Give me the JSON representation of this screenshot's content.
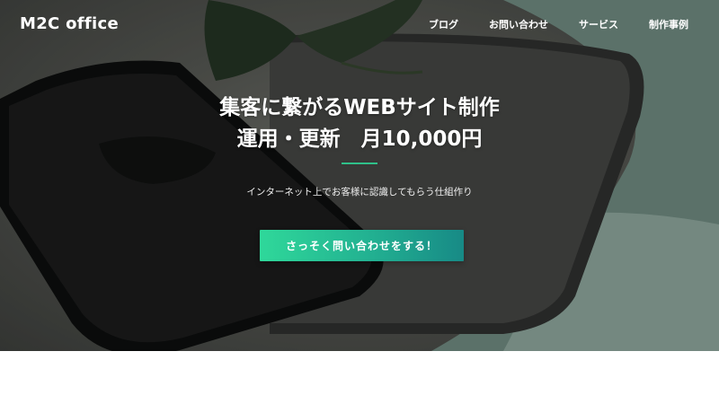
{
  "header": {
    "logo": "M2C office",
    "nav": [
      {
        "label": "ブログ"
      },
      {
        "label": "お問い合わせ"
      },
      {
        "label": "サービス"
      },
      {
        "label": "制作事例"
      }
    ]
  },
  "hero": {
    "headline_line1": "集客に繋がるWEBサイト制作",
    "headline_line2": "運用・更新　月10,000円",
    "subtitle": "インターネット上でお客様に認識してもらう仕組作り",
    "cta_label": "さっそく問い合わせをする！",
    "accent_color": "#2fc08a"
  }
}
